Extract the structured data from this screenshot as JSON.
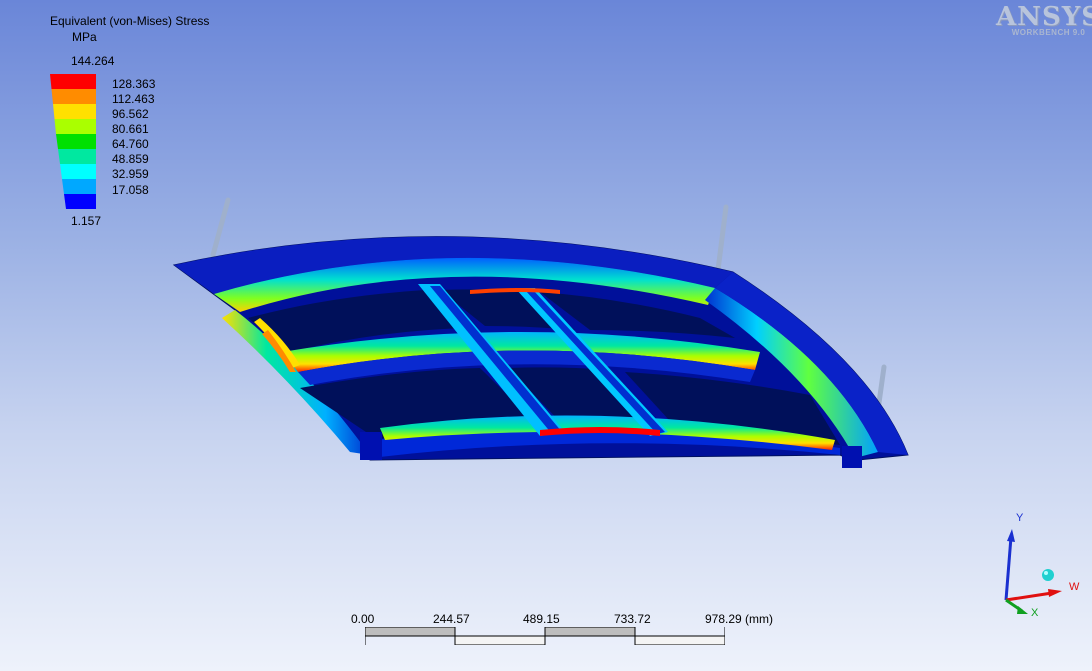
{
  "legend": {
    "title": "Equivalent (von-Mises) Stress",
    "unit": "MPa",
    "max": "144.264",
    "min": "1.157",
    "levels": [
      "128.363",
      "112.463",
      "96.562",
      "80.661",
      "64.760",
      "48.859",
      "32.959",
      "17.058"
    ],
    "colors": [
      "#ff0000",
      "#ff8c00",
      "#ffe000",
      "#aaff00",
      "#00e000",
      "#00e8a0",
      "#00ffff",
      "#00a8ff",
      "#0000ff"
    ]
  },
  "logo": {
    "name": "ANSYS",
    "product": "WORKBENCH 9.0"
  },
  "scale": {
    "ticks": [
      "0.00",
      "244.57",
      "489.15",
      "733.72",
      "978.29 (mm)"
    ]
  },
  "triad": {
    "y": "Y",
    "w": "W",
    "x": "X"
  }
}
